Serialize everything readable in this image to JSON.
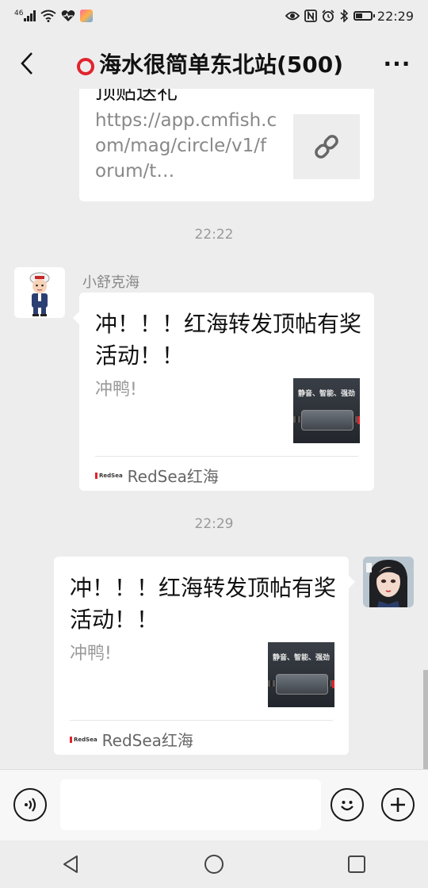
{
  "status_bar": {
    "network_label": "46",
    "time": "22:29",
    "icons": [
      "signal-icon",
      "wifi-icon",
      "heart-icon",
      "app-badge-icon",
      "eye-icon",
      "nfc-icon",
      "alarm-icon",
      "bluetooth-icon",
      "battery-icon"
    ]
  },
  "nav": {
    "title": "海水很简单东北站(500)",
    "more_label": "···"
  },
  "messages": {
    "link_card": {
      "title_partial": "顶贴送礼",
      "url_text": "https://app.cmfish.com/mag/circle/v1/forum/t…"
    },
    "time_1": "22:22",
    "incoming": {
      "sender": "小舒克海",
      "title": "冲！！！红海转发顶帖有奖活动！！",
      "desc": "冲鸭!",
      "image_text": "静音、智能、强劲",
      "source_logo": "RedSea",
      "source": "RedSea红海"
    },
    "time_2": "22:29",
    "outgoing": {
      "title": "冲！！！红海转发顶帖有奖活动！！",
      "desc": "冲鸭!",
      "image_text": "静音、智能、强劲",
      "source_logo": "RedSea",
      "source": "RedSea红海"
    }
  },
  "input_bar": {
    "text_value": "",
    "buttons": [
      "voice-icon",
      "emoji-icon",
      "plus-icon"
    ]
  },
  "system_nav": {
    "buttons": [
      "back-triangle-icon",
      "home-circle-icon",
      "recents-square-icon"
    ]
  },
  "colors": {
    "background": "#ededed",
    "bubble": "#ffffff",
    "accent_red": "#e0242c"
  }
}
